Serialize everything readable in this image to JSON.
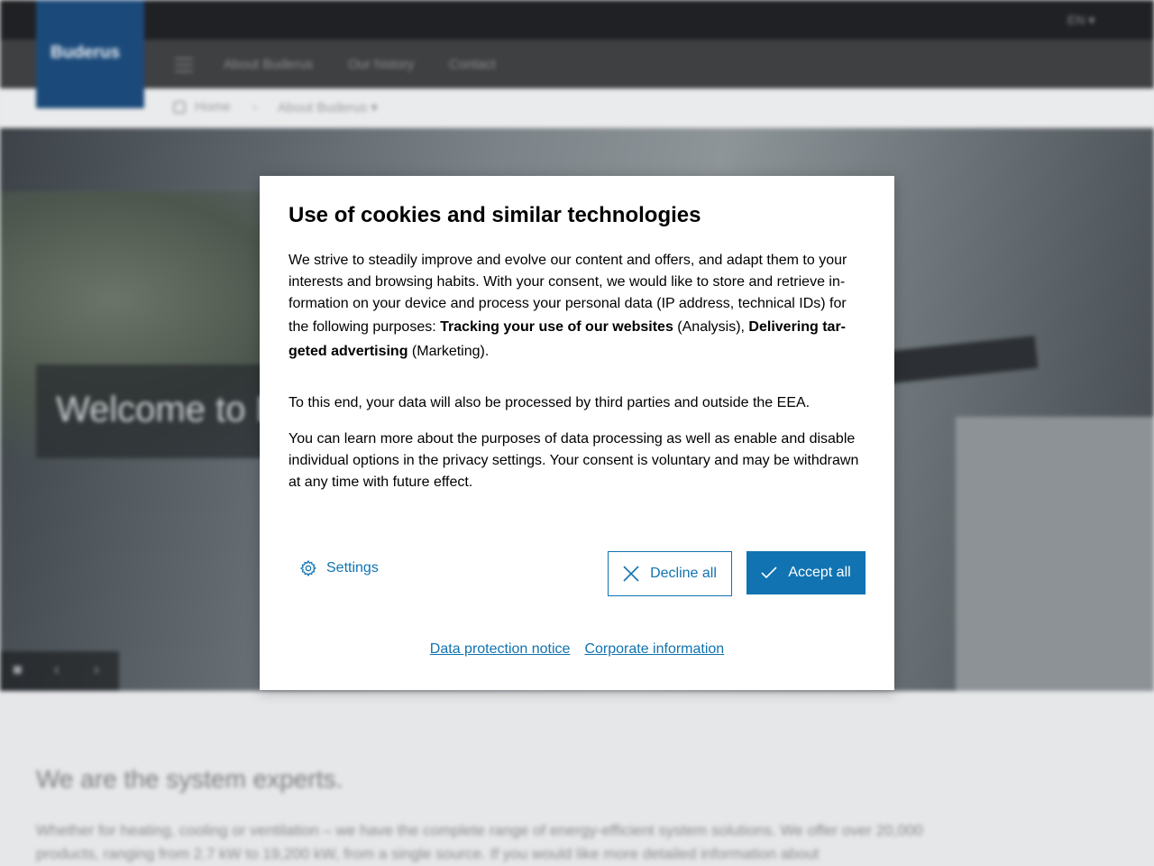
{
  "background": {
    "brand": "Buderus",
    "brand_color": "#1b4a7a",
    "language": "EN",
    "nav_items": [
      "About Buderus",
      "Our history",
      "Contact"
    ],
    "breadcrumb": [
      "Home",
      "About Buderus"
    ],
    "hero_title": "Welcome to B",
    "content_title": "We are the system experts.",
    "content_text": "Whether for heating, cooling or ventilation – we have the complete range of energy-efficient system solutions. We offer over 20,000 products, ranging from 2.7 kW to 19,200 kW, from a single source. If you would like more detailed information about"
  },
  "dialog": {
    "title": "Use of cookies and similar technologies",
    "p1_text_a": "We strive to steadily improve and evolve our content and offers, and adapt them to your interests and browsing habits. With your consent, we would like to store and retrieve in-formation on your device and process your personal data (IP address, technical IDs) for the following purposes: ",
    "p1_bold_a": "Tracking your use of our websites",
    "p1_text_b": " (Analysis), ",
    "p1_bold_b": "Delivering tar-geted advertising",
    "p1_text_c": " (Marketing).",
    "p2": "To this end, your data will also be processed by third parties and outside the EEA.",
    "p3": "You can learn more about the purposes of data processing as well as enable and disable individual options in the privacy settings. Your consent is voluntary and may be withdrawn at any time with future effect.",
    "settings_label": "Settings",
    "decline_label": "Decline all",
    "accept_label": "Accept all",
    "link_privacy": "Data protection notice",
    "link_corporate": "Corporate information",
    "accent_color": "#1173b1"
  }
}
